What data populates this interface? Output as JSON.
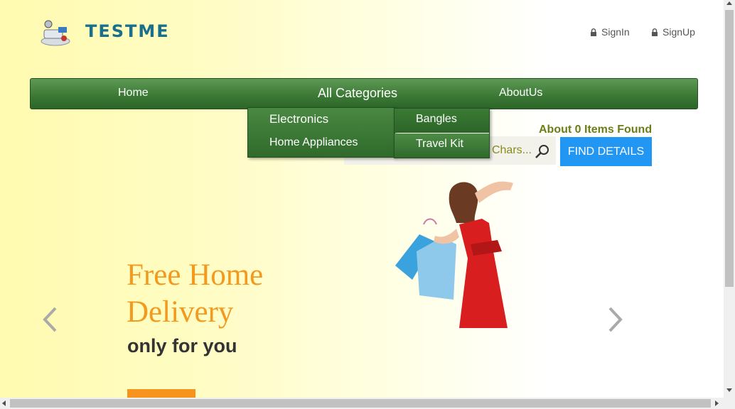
{
  "header": {
    "logo_text": "TESTME",
    "signin_label": "SignIn",
    "signup_label": "SignUp"
  },
  "nav": {
    "home_label": "Home",
    "categories_label": "All Categories",
    "about_label": "AboutUs"
  },
  "dropdown": {
    "items": [
      "Electronics",
      "Home Appliances"
    ]
  },
  "submenu": {
    "items": [
      "Bangles",
      "Travel Kit"
    ]
  },
  "search": {
    "results_text": "About 0 Items Found",
    "placeholder": "Enter Product Chars...",
    "button_label": "FIND DETAILS"
  },
  "slide": {
    "title": "Free Home Delivery",
    "subtitle": "only for you"
  },
  "colors": {
    "nav_green": "#3c7a36",
    "accent_blue": "#2196f3",
    "accent_orange": "#f39a1e",
    "logo_teal": "#1a6f8a"
  },
  "icons": [
    "lock-icon",
    "search-icon",
    "chevron-left-icon",
    "chevron-right-icon"
  ]
}
